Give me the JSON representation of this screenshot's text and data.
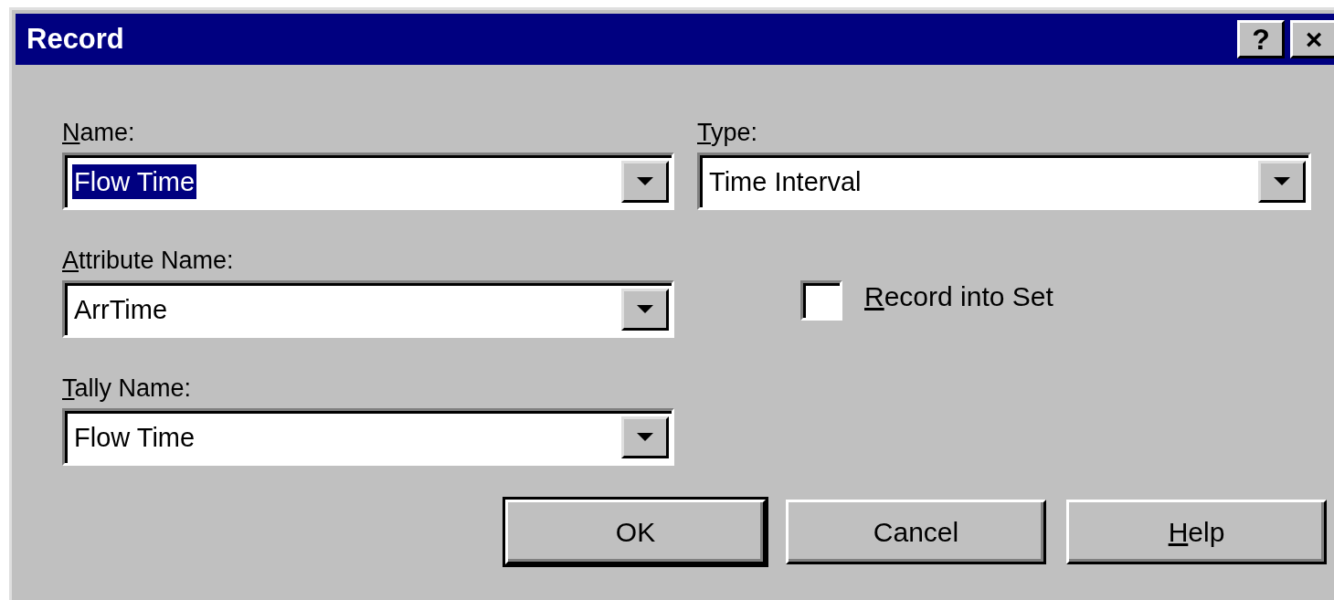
{
  "window": {
    "title": "Record",
    "title_buttons": [
      "?",
      "×"
    ]
  },
  "fields": [
    {
      "label": "Name:",
      "mnemonic": true,
      "value": "Flow Time",
      "text_selected": true
    },
    {
      "label": "Attribute Name:",
      "mnemonic": true,
      "value": "ArrTime",
      "text_selected": false
    },
    {
      "label": "Tally Name:",
      "mnemonic": true,
      "value": "Flow Time",
      "text_selected": false
    }
  ],
  "type_field": {
    "label": "Type:",
    "mnemonic": true,
    "value": "Time Interval",
    "text_selected": false
  },
  "checkbox": {
    "label": "Record into Set",
    "mnemonic": true,
    "checked": false
  },
  "buttons": [
    {
      "label": "OK",
      "mnemonic": false,
      "default": true
    },
    {
      "label": "Cancel",
      "mnemonic": false,
      "default": false
    },
    {
      "label": "Help",
      "mnemonic": true,
      "default": false
    }
  ]
}
